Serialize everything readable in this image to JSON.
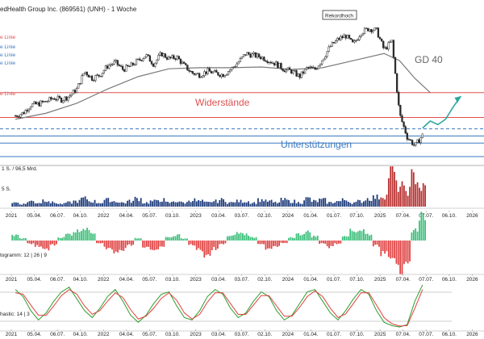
{
  "chart_data": [
    {
      "type": "line",
      "title": "edHealth Group Inc. (869561) (UNH) - 1 Woche",
      "annotations": {
        "top_badge": "Rekordhoch",
        "resistance_label": "Widerstände",
        "support_label": "Unterstützungen",
        "ma_label": "GD 40",
        "left_line_labels": [
          "e Linie",
          "e Linie",
          "e Linie",
          "e Linie",
          "e Linie"
        ]
      },
      "price_series": {
        "name": "",
        "x": [
          "2021-03",
          "2021-04",
          "2021-05",
          "2021-06",
          "2021-07",
          "2021-08",
          "2021-09",
          "2021-10",
          "2021-11",
          "2021-12",
          "2022-01",
          "2022-02",
          "2022-03",
          "2022-04",
          "2022-05",
          "2022-06",
          "2022-07",
          "2022-08",
          "2022-09",
          "2022-10",
          "2022-11",
          "2022-12",
          "2023-01",
          "2023-02",
          "2023-03",
          "2023-04",
          "2023-05",
          "2023-06",
          "2023-07",
          "2023-08",
          "2023-09",
          "2023-10",
          "2023-11",
          "2023-12",
          "2024-01",
          "2024-02",
          "2024-03",
          "2024-04",
          "2024-05",
          "2024-06",
          "2024-07",
          "2024-08",
          "2024-09",
          "2024-10",
          "2024-11",
          "2024-12",
          "2025-01",
          "2025-02",
          "2025-03",
          "2025-04",
          "2025-05",
          "2025-06",
          "2025-07",
          "2025-08"
        ],
        "y": [
          365,
          372,
          395,
          398,
          405,
          415,
          410,
          420,
          440,
          490,
          470,
          480,
          505,
          515,
          495,
          505,
          520,
          535,
          510,
          540,
          525,
          530,
          505,
          485,
          480,
          490,
          485,
          480,
          495,
          515,
          540,
          535,
          530,
          520,
          510,
          495,
          490,
          475,
          500,
          495,
          525,
          560,
          580,
          590,
          565,
          600,
          610,
          605,
          550,
          575,
          370,
          305,
          280,
          310
        ]
      },
      "moving_average": {
        "name": "GD 40",
        "x": [
          "2021-03",
          "2021-07",
          "2021-11",
          "2022-03",
          "2022-07",
          "2022-11",
          "2023-03",
          "2023-07",
          "2023-11",
          "2024-03",
          "2024-07",
          "2024-11",
          "2025-03",
          "2025-05",
          "2025-07",
          "2025-09"
        ],
        "y": [
          355,
          372,
          400,
          440,
          475,
          497,
          500,
          500,
          502,
          495,
          500,
          520,
          540,
          520,
          470,
          430
        ]
      },
      "projection": {
        "x": [
          "2025-08",
          "2025-09",
          "2025-10",
          "2025-11",
          "2025-12",
          "2026-01"
        ],
        "y": [
          330,
          350,
          340,
          355,
          390,
          420
        ]
      },
      "horizontal_lines": [
        {
          "role": "resistance",
          "value": 430,
          "color": "#e05050"
        },
        {
          "role": "resistance",
          "value": 360,
          "color": "#e05050"
        },
        {
          "role": "dashed",
          "value": 328,
          "color": "#3a78c0"
        },
        {
          "role": "support",
          "value": 308,
          "color": "#3a78c0"
        },
        {
          "role": "support",
          "value": 288,
          "color": "#3a78c0"
        },
        {
          "role": "support",
          "value": 250,
          "color": "#3a78c0"
        }
      ],
      "ylim": [
        225,
        645
      ],
      "x_tick_labels": [
        "2021",
        "05.04.",
        "06.07.",
        "04.10.",
        "2022",
        "04.04.",
        "05.07.",
        "03.10.",
        "2023",
        "03.04.",
        "03.07.",
        "02.10.",
        "2024",
        "01.04.",
        "01.07.",
        "07.10.",
        "2025",
        "07.04.",
        "07.07.",
        "06.10.",
        "2026"
      ],
      "grid": false
    },
    {
      "type": "bar",
      "title": "1 S. / 96,5 Mrd.",
      "sublabel": "5 S.",
      "description_values": [
        3,
        2,
        4,
        3,
        5,
        3,
        2,
        3,
        4,
        6,
        4,
        3,
        5,
        4,
        3,
        4,
        6,
        3,
        4,
        5,
        3,
        4,
        3,
        5,
        4,
        3,
        4,
        5,
        3,
        4,
        4,
        3,
        5,
        4,
        3,
        5,
        4,
        3,
        6,
        4,
        5,
        3,
        4,
        5,
        3,
        4,
        6,
        7,
        8,
        25,
        15,
        12,
        22,
        14
      ],
      "highlight_color": "#b83030",
      "base_color": "#1c3a7a"
    },
    {
      "type": "bar",
      "title": "togramm: 12 | 26 | 9",
      "values": [
        0.5,
        0.2,
        -0.3,
        -0.5,
        -0.8,
        -0.4,
        0.3,
        0.6,
        0.9,
        1.2,
        0.8,
        -0.3,
        -0.7,
        -1.0,
        -0.8,
        -0.4,
        0.2,
        -0.6,
        -1.1,
        -0.7,
        0.3,
        0.5,
        0.2,
        -0.4,
        -0.9,
        -1.3,
        -0.8,
        -0.3,
        0.4,
        0.7,
        0.6,
        0.3,
        -0.4,
        -0.7,
        -0.5,
        -0.2,
        0.3,
        0.6,
        0.8,
        0.4,
        -0.3,
        -0.6,
        -0.3,
        0.5,
        0.9,
        1.0,
        0.6,
        -0.5,
        -1.2,
        -2.0,
        -2.6,
        -1.8,
        1.0,
        2.4
      ],
      "positive_color": "#3cbf7a",
      "negative_color": "#e04545"
    },
    {
      "type": "line",
      "title": "hastic: 14 | 3",
      "series": [
        {
          "name": "",
          "color": "#2d9e2d",
          "values": [
            85,
            70,
            40,
            20,
            35,
            60,
            80,
            90,
            65,
            40,
            25,
            45,
            70,
            85,
            60,
            30,
            15,
            30,
            55,
            75,
            80,
            50,
            25,
            20,
            40,
            70,
            85,
            75,
            45,
            25,
            35,
            60,
            80,
            70,
            40,
            20,
            30,
            55,
            80,
            85,
            60,
            35,
            20,
            40,
            65,
            85,
            75,
            40,
            15,
            8,
            5,
            10,
            60,
            95
          ]
        },
        {
          "name": "",
          "color": "#e04040",
          "values": [
            78,
            75,
            52,
            30,
            30,
            50,
            72,
            85,
            75,
            50,
            32,
            40,
            60,
            78,
            68,
            42,
            22,
            28,
            45,
            66,
            78,
            62,
            35,
            22,
            32,
            58,
            78,
            78,
            55,
            32,
            32,
            52,
            72,
            72,
            50,
            28,
            28,
            47,
            70,
            82,
            70,
            45,
            25,
            33,
            55,
            78,
            78,
            52,
            25,
            12,
            7,
            8,
            45,
            85
          ]
        }
      ],
      "ylim": [
        0,
        100
      ]
    }
  ]
}
